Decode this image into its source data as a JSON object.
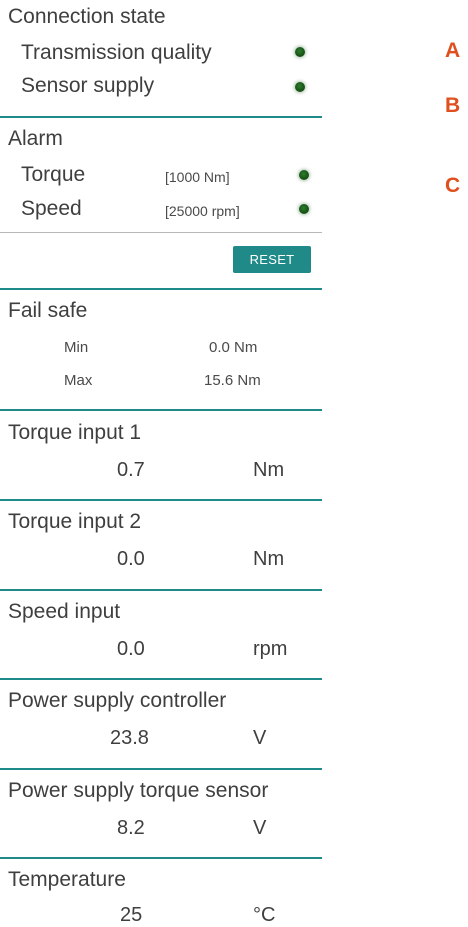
{
  "connection": {
    "title": "Connection state",
    "items": [
      {
        "label": "Transmission quality"
      },
      {
        "label": "Sensor supply"
      }
    ]
  },
  "alarm": {
    "title": "Alarm",
    "items": [
      {
        "label": "Torque",
        "limit": "[1000 Nm]"
      },
      {
        "label": "Speed",
        "limit": "[25000 rpm]"
      }
    ],
    "reset_label": "RESET"
  },
  "fail_safe": {
    "title": "Fail safe",
    "rows": [
      {
        "label": "Min",
        "value": "0.0 Nm"
      },
      {
        "label": "Max",
        "value": "15.6 Nm"
      }
    ]
  },
  "readouts": [
    {
      "title": "Torque input 1",
      "value": "0.7",
      "unit": "Nm"
    },
    {
      "title": "Torque input 2",
      "value": "0.0",
      "unit": "Nm"
    },
    {
      "title": "Speed input",
      "value": "0.0",
      "unit": "rpm"
    },
    {
      "title": "Power supply controller",
      "value": "23.8",
      "unit": "V"
    },
    {
      "title": "Power supply torque sensor",
      "value": "8.2",
      "unit": "V"
    },
    {
      "title": "Temperature",
      "value": "25",
      "unit": "°C"
    }
  ],
  "markers": [
    "A",
    "B",
    "C"
  ],
  "colors": {
    "accent": "#1f8a88",
    "led_ok": "#175717",
    "marker": "#e0501e"
  }
}
